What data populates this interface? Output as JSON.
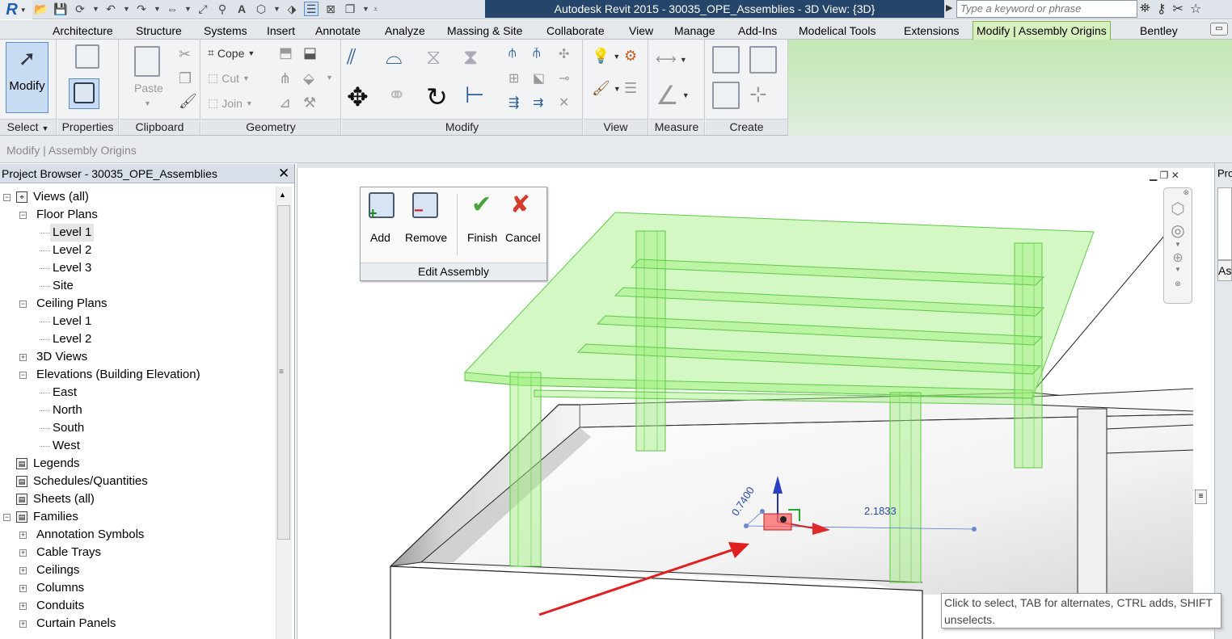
{
  "app": {
    "title": "Autodesk Revit 2015 -      30035_OPE_Assemblies - 3D View: {3D}",
    "logo": "R"
  },
  "search": {
    "placeholder": "Type a keyword or phrase"
  },
  "tabs": [
    "Architecture",
    "Structure",
    "Systems",
    "Insert",
    "Annotate",
    "Analyze",
    "Massing & Site",
    "Collaborate",
    "View",
    "Manage",
    "Add-Ins",
    "Modelical Tools",
    "Extensions",
    "Modify | Assembly Origins",
    "Bentley"
  ],
  "active_tab": "Modify | Assembly Origins",
  "ribbon": {
    "modify_label": "Modify",
    "select_label": "Select",
    "properties_label": "Properties",
    "clipboard_label": "Clipboard",
    "paste_label": "Paste",
    "geometry_label": "Geometry",
    "cope_label": "Cope",
    "cut_label": "Cut",
    "join_label": "Join",
    "modify_panel_label": "Modify",
    "view_label": "View",
    "measure_label": "Measure",
    "create_label": "Create"
  },
  "context_bar": {
    "label": "Modify | Assembly Origins"
  },
  "project_browser": {
    "title": "Project Browser - 30035_OPE_Assemblies",
    "close": "✕",
    "items": {
      "views": "Views (all)",
      "floor_plans": "Floor Plans",
      "fp_level1": "Level 1",
      "fp_level2": "Level 2",
      "fp_level3": "Level 3",
      "fp_site": "Site",
      "ceiling_plans": "Ceiling Plans",
      "cp_level1": "Level 1",
      "cp_level2": "Level 2",
      "views_3d": "3D Views",
      "elevations": "Elevations (Building Elevation)",
      "el_east": "East",
      "el_north": "North",
      "el_south": "South",
      "el_west": "West",
      "legends": "Legends",
      "schedules": "Schedules/Quantities",
      "sheets": "Sheets (all)",
      "families": "Families",
      "fam_annotation": "Annotation Symbols",
      "fam_cable": "Cable Trays",
      "fam_ceilings": "Ceilings",
      "fam_columns": "Columns",
      "fam_conduits": "Conduits",
      "fam_curtain": "Curtain Panels"
    }
  },
  "edit_assembly": {
    "add": "Add",
    "remove": "Remove",
    "finish": "Finish",
    "cancel": "Cancel",
    "title": "Edit Assembly"
  },
  "dimensions": {
    "d1": "0.7400",
    "d2": "2.1833"
  },
  "right_panel": {
    "tab": "Pro",
    "field": "As"
  },
  "tooltip": "Click to select, TAB for alternates, CTRL adds, SHIFT unselects.",
  "colors": {
    "title_bg": "#26456b",
    "context_tab": "#d8f0c0",
    "assembly_green": "#8de86e",
    "arrow_red": "#e02020"
  }
}
